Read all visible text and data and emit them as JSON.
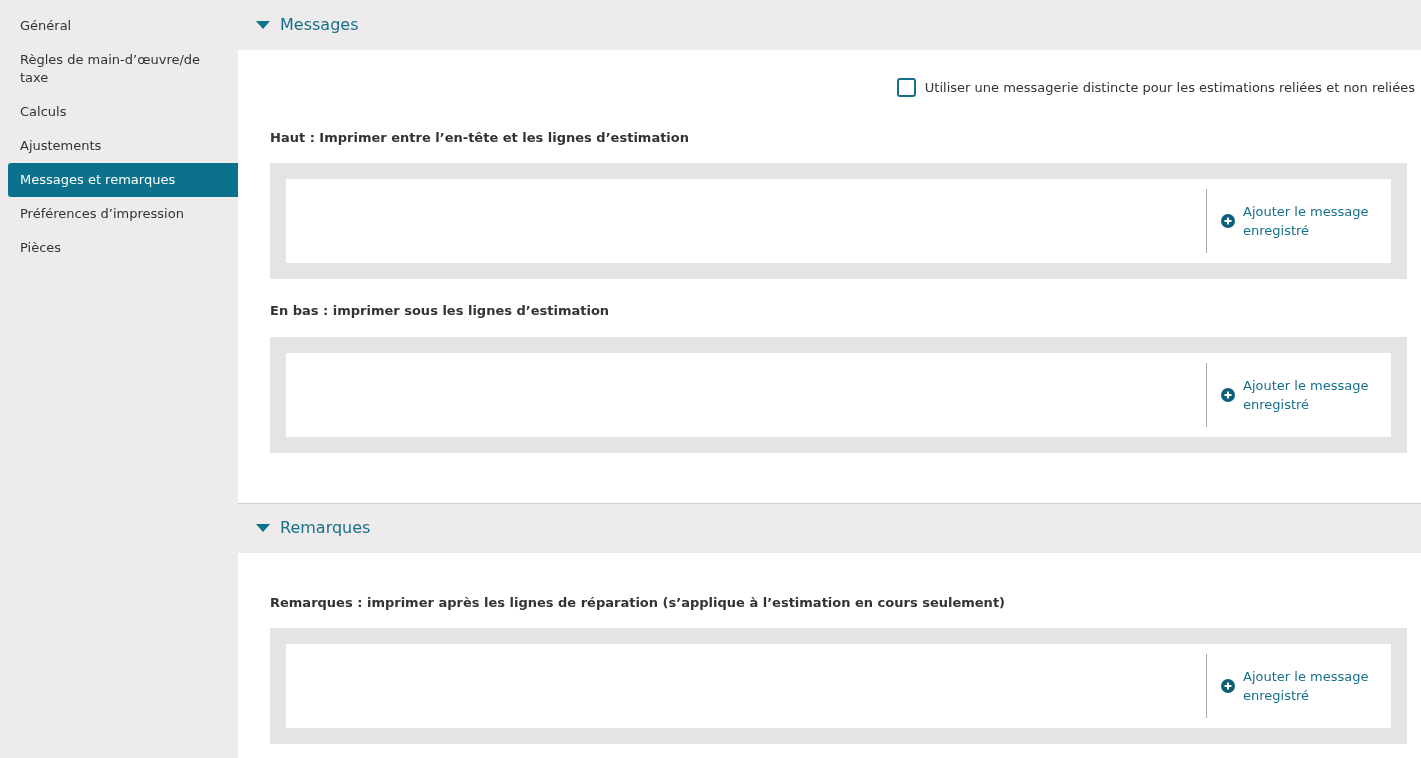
{
  "sidebar": {
    "items": [
      {
        "label": "Général",
        "selected": false
      },
      {
        "label": "Règles de main-d’œuvre/de taxe",
        "selected": false
      },
      {
        "label": "Calculs",
        "selected": false
      },
      {
        "label": "Ajustements",
        "selected": false
      },
      {
        "label": "Messages et remarques",
        "selected": true
      },
      {
        "label": "Préférences d’impression",
        "selected": false
      },
      {
        "label": "Pièces",
        "selected": false
      }
    ]
  },
  "sections": [
    {
      "title": "Messages",
      "expanded": true,
      "option": {
        "label": "Utiliser une messagerie distincte pour les estimations reliées et non reliées",
        "checked": false
      },
      "fields": [
        {
          "label": "Haut : Imprimer entre l’en-tête et les lignes d’estimation",
          "button": "Ajouter le message enregistré"
        },
        {
          "label": "En bas : imprimer sous les lignes d’estimation",
          "button": "Ajouter le message enregistré"
        }
      ]
    },
    {
      "title": "Remarques",
      "expanded": true,
      "fields": [
        {
          "label": "Remarques : imprimer après les lignes de réparation (s’applique à l’estimation en cours seulement)",
          "button": "Ajouter le message enregistré"
        }
      ]
    }
  ]
}
